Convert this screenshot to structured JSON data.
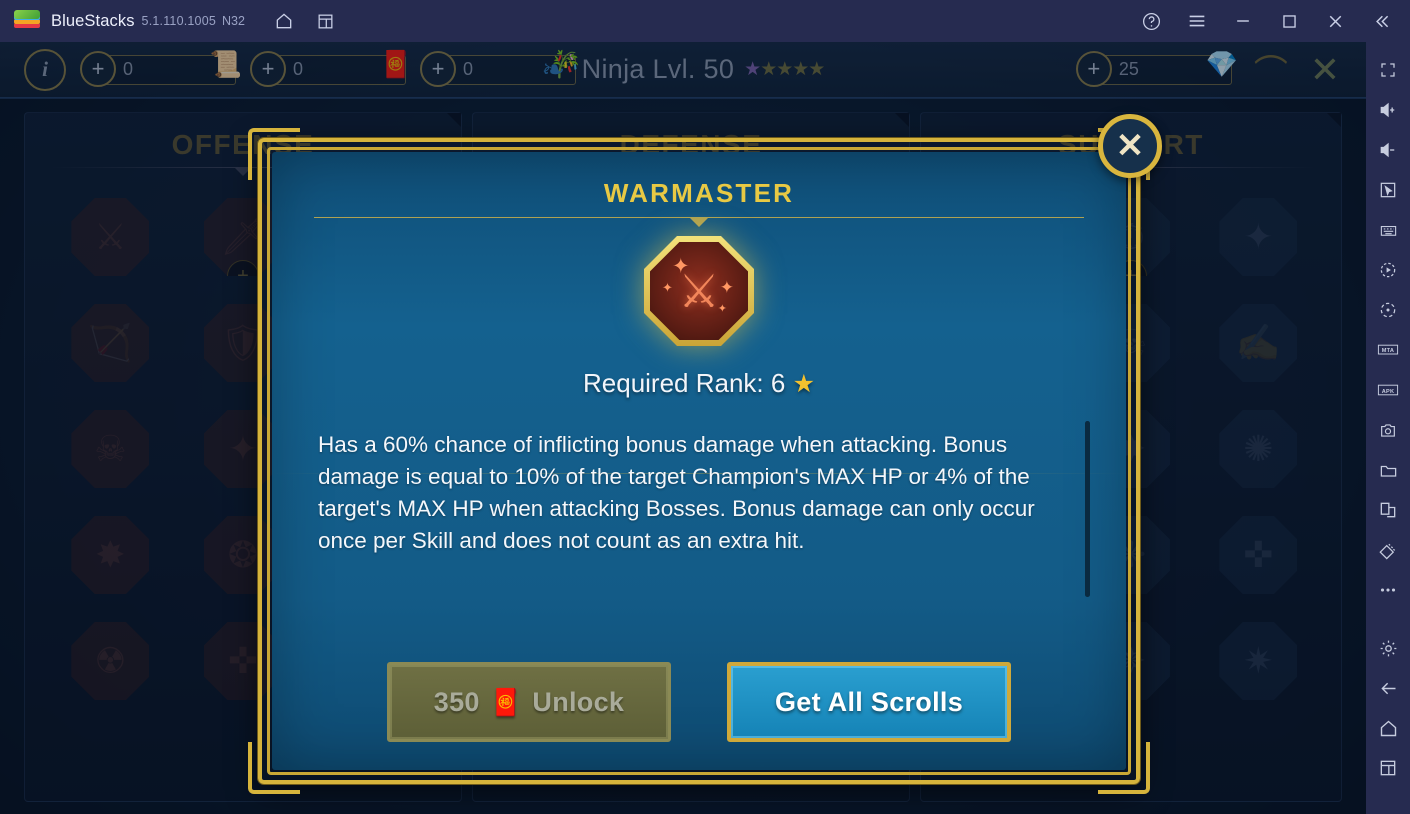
{
  "titlebar": {
    "app_name": "BlueStacks",
    "version": "5.1.110.1005",
    "build": "N32",
    "icons": {
      "logo": "bluestacks-logo",
      "home": "home-icon",
      "instances": "multi-instance-icon",
      "help": "help-icon",
      "menu": "hamburger-menu-icon",
      "minimize": "minimize-icon",
      "maximize": "maximize-icon",
      "close": "close-icon",
      "collapse": "collapse-sidebar-icon"
    }
  },
  "game_header": {
    "info_label": "i",
    "currencies": [
      {
        "name": "mastery-scroll-grey",
        "plus": "+",
        "value": "0",
        "icon": "📜"
      },
      {
        "name": "mastery-scroll-green",
        "plus": "+",
        "value": "0",
        "icon": "🧧"
      },
      {
        "name": "mastery-scroll-red",
        "plus": "+",
        "value": "0",
        "icon": "🎋"
      }
    ],
    "champion": {
      "affinity_icon": "spirit-affinity-icon",
      "name": "Ninja Lvl. 50",
      "stars_filled": 1,
      "stars_total": 5
    },
    "gems": {
      "plus": "+",
      "value": "25",
      "icon": "💎"
    },
    "close_label": "✕"
  },
  "background_panels": [
    {
      "title": "OFFENSE"
    },
    {
      "title": "DEFENSE"
    },
    {
      "title": "SUPPORT"
    }
  ],
  "modal": {
    "title": "WARMASTER",
    "close_label": "✕",
    "icon_name": "warmaster-mastery-icon",
    "icon_glyph": "⚔",
    "sparkles": [
      "✦",
      "✦",
      "✦",
      "✦"
    ],
    "required_rank_label": "Required Rank: 6",
    "required_rank_star": "★",
    "description": "Has a 60% chance of inflicting bonus damage when attacking. Bonus damage is equal to 10% of the target Champion's MAX HP or 4% of the target's MAX HP when attacking Bosses. Bonus damage can only occur once per Skill and does not count as an extra hit.",
    "buttons": {
      "unlock_cost": "350",
      "unlock_scroll_icon": "🧧",
      "unlock_label": "Unlock",
      "get_all_label": "Get All Scrolls"
    }
  },
  "sidebar": {
    "items": [
      {
        "name": "fullscreen-icon"
      },
      {
        "name": "volume-up-icon"
      },
      {
        "name": "volume-down-icon"
      },
      {
        "name": "cursor-click-icon"
      },
      {
        "name": "keyboard-controls-icon"
      },
      {
        "name": "macro-record-icon"
      },
      {
        "name": "rotate-screen-icon"
      },
      {
        "name": "mta-icon",
        "text": "MTA"
      },
      {
        "name": "apk-install-icon",
        "text": "APK"
      },
      {
        "name": "screenshot-icon"
      },
      {
        "name": "media-folder-icon"
      },
      {
        "name": "multi-instance-icon"
      },
      {
        "name": "eco-mode-icon"
      },
      {
        "name": "more-options-icon"
      },
      {
        "name": "settings-gear-icon"
      },
      {
        "name": "back-arrow-icon"
      },
      {
        "name": "home-icon"
      },
      {
        "name": "recents-icon"
      }
    ]
  },
  "colors": {
    "titlebar_bg": "#262b50",
    "modal_gold": "#d6b43c",
    "modal_blue": "#14618f",
    "primary_button": "#2a9fd0",
    "disabled_button": "#6f7044",
    "title_gold": "#e8c944"
  }
}
